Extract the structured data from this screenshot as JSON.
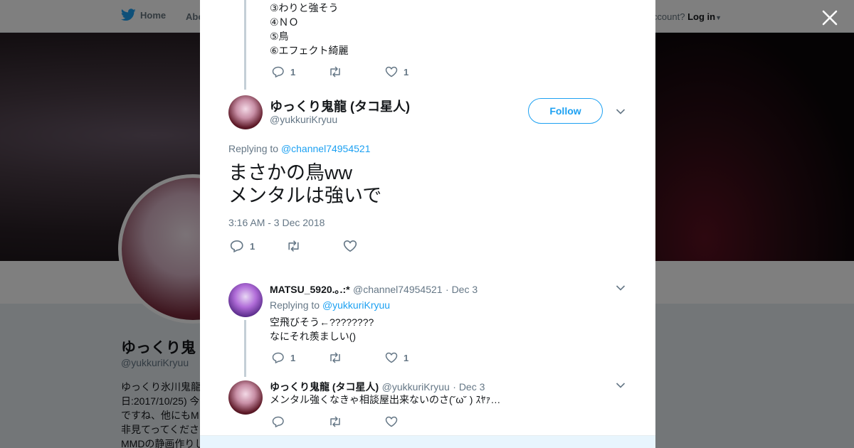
{
  "background": {
    "nav": {
      "home_label": "Home",
      "about_label": "Abo",
      "account_text": "ccount?",
      "login_label": "Log in"
    },
    "profile": {
      "name": "ゆっくり鬼",
      "handle": "@yukkuriKryuu",
      "bio_lines": [
        "ゆっくり氷川鬼龍",
        "日:2017/10/25) 今",
        "ですね、他にもM",
        "非見てってくださ",
        "MMDの静画作りし"
      ]
    }
  },
  "context_tweet": {
    "lines": [
      "③わりと強そう",
      "④ＮＯ",
      "⑤鳥",
      "⑥エフェクト綺麗"
    ],
    "reply_count": "1",
    "retweet_count": "",
    "like_count": "1"
  },
  "main_tweet": {
    "fullname": "ゆっくり鬼龍 (タコ星人)",
    "handle": "@yukkuriKryuu",
    "follow_label": "Follow",
    "replying_prefix": "Replying to",
    "replying_to": "@channel74954521",
    "text_line1": "まさかの鳥ww",
    "text_line2": "メンタルは強いで",
    "timestamp": "3:16 AM - 3 Dec 2018",
    "reply_count": "1",
    "retweet_count": "",
    "like_count": ""
  },
  "replies": [
    {
      "fullname": "MATSU_5920.｡.:*",
      "handle": "@channel74954521",
      "date": "· Dec 3",
      "replying_prefix": "Replying to",
      "replying_to": "@yukkuriKryuu",
      "line1": "空飛びそう←????????",
      "line2": "なにそれ羨ましい()",
      "reply_count": "1",
      "retweet_count": "",
      "like_count": "1"
    },
    {
      "fullname": "ゆっくり鬼龍 (タコ星人)",
      "handle": "@yukkuriKryuu",
      "date": "· Dec 3",
      "line1": "メンタル強くなきゃ相談屋出来ないのさ(˘ω˘ ) ｽﾔｧ…",
      "reply_count": "",
      "retweet_count": "",
      "like_count": ""
    }
  ],
  "colors": {
    "accent": "#1da1f2",
    "muted": "#657786",
    "thread_line": "#c4cfd6",
    "overlay": "rgba(0,0,0,0.5)"
  }
}
